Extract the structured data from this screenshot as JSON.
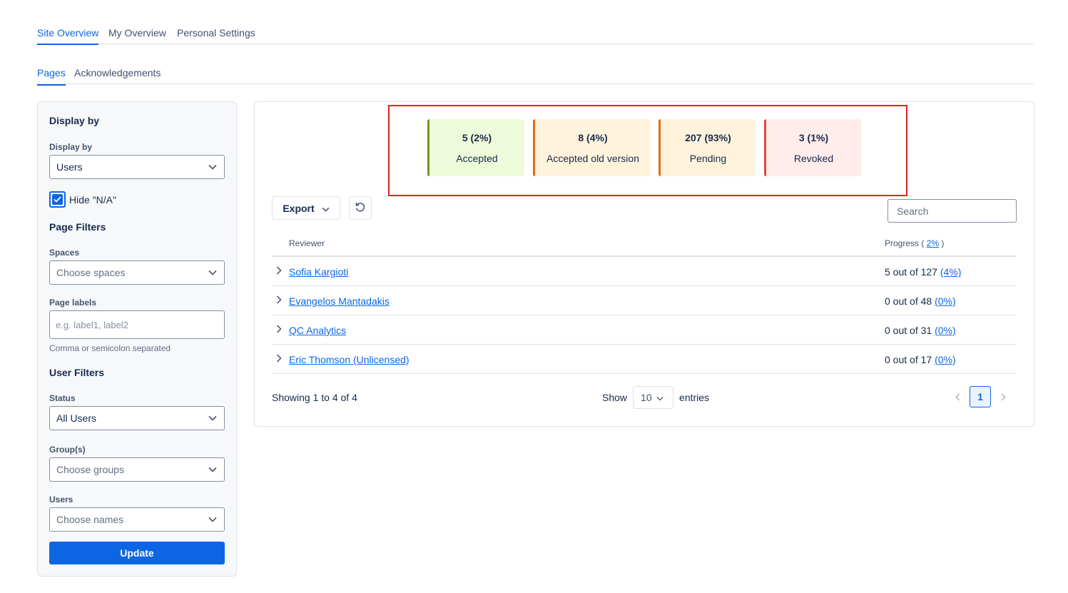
{
  "top_tabs": [
    {
      "label": "Site Overview",
      "active": true
    },
    {
      "label": "My Overview",
      "active": false
    },
    {
      "label": "Personal Settings",
      "active": false
    }
  ],
  "sub_tabs": [
    {
      "label": "Pages",
      "active": true
    },
    {
      "label": "Acknowledgements",
      "active": false
    }
  ],
  "sidebar": {
    "display_heading": "Display by",
    "display_label": "Display by",
    "display_value": "Users",
    "hide_na_label": "Hide \"N/A\"",
    "hide_na_checked": true,
    "page_filters_heading": "Page Filters",
    "spaces_label": "Spaces",
    "spaces_placeholder": "Choose spaces",
    "labels_label": "Page labels",
    "labels_placeholder": "e.g. label1, label2",
    "labels_helper": "Comma or semicolon separated",
    "user_filters_heading": "User Filters",
    "status_label": "Status",
    "status_value": "All Users",
    "groups_label": "Group(s)",
    "groups_placeholder": "Choose groups",
    "users_label": "Users",
    "users_placeholder": "Choose names",
    "update_label": "Update"
  },
  "stats": [
    {
      "value": "5 (2%)",
      "label": "Accepted",
      "bg": "#eefbda",
      "border": "#6a9a23"
    },
    {
      "value": "8 (4%)",
      "label": "Accepted old version",
      "bg": "#fff3dc",
      "border": "#e56910"
    },
    {
      "value": "207 (93%)",
      "label": "Pending",
      "bg": "#fff3dc",
      "border": "#e56910"
    },
    {
      "value": "3 (1%)",
      "label": "Revoked",
      "bg": "#ffeceb",
      "border": "#e2483d"
    }
  ],
  "toolbar": {
    "export_label": "Export",
    "search_placeholder": "Search"
  },
  "table": {
    "col_reviewer": "Reviewer",
    "col_progress_prefix": "Progress (",
    "col_progress_pct": "2%",
    "col_progress_suffix": ")",
    "rows": [
      {
        "name": "Sofia Kargioti",
        "progress": "5 out of 127",
        "pct": "(4%)"
      },
      {
        "name": "Evangelos Mantadakis",
        "progress": "0 out of 48",
        "pct": "(0%)"
      },
      {
        "name": "QC Analytics",
        "progress": "0 out of 31",
        "pct": "(0%)"
      },
      {
        "name": "Eric Thomson (Unlicensed)",
        "progress": "0 out of 17",
        "pct": "(0%)"
      }
    ]
  },
  "footer": {
    "showing": "Showing 1 to 4 of 4",
    "show_label": "Show",
    "page_size": "10",
    "entries_label": "entries",
    "current_page": "1"
  },
  "colors": {
    "accent": "#0c66e4",
    "highlight_box": "#e2231a"
  }
}
